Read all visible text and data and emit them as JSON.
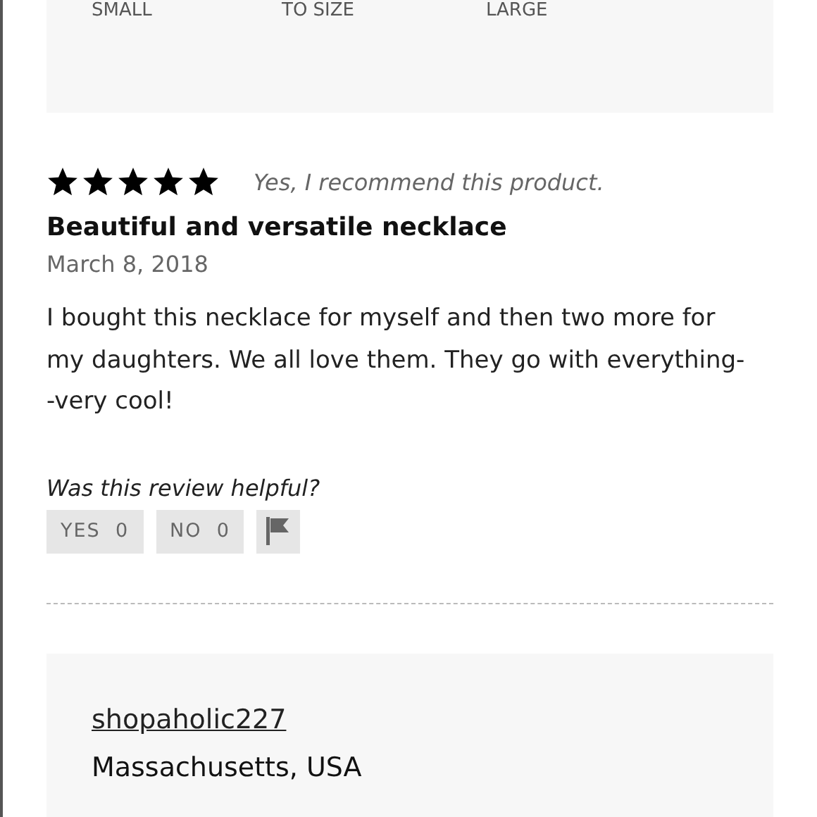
{
  "fit_scale": {
    "labels": [
      "SMALL",
      "TO SIZE",
      "LARGE"
    ]
  },
  "review": {
    "stars": 5,
    "recommend": "Yes, I recommend this product.",
    "title": "Beautiful and versatile necklace",
    "date": "March 8, 2018",
    "body": "I bought this necklace for myself and then two more for my daughters. We all love them. They go with everything--very cool!",
    "helpful_prompt": "Was this review helpful?",
    "votes": [
      {
        "label": "YES",
        "count": "0"
      },
      {
        "label": "NO",
        "count": "0"
      }
    ]
  },
  "reviewer": {
    "username": "shopaholic227",
    "location": "Massachusetts, USA"
  }
}
